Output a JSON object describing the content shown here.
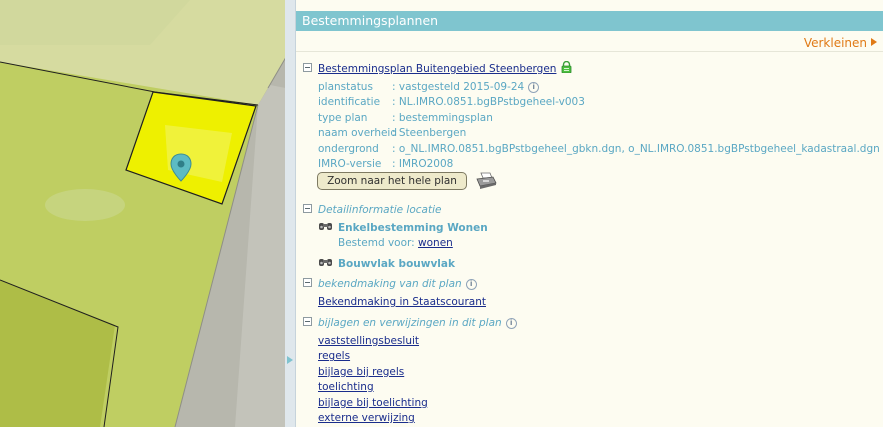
{
  "panel": {
    "title": "Bestemmingsplannen",
    "collapse_label": "Verkleinen",
    "plan": {
      "name": "Bestemmingsplan Buitengebied Steenbergen",
      "properties": [
        {
          "key": "planstatus",
          "value": ": vastgesteld 2015-09-24",
          "info": true
        },
        {
          "key": "identificatie",
          "value": ": NL.IMRO.0851.bgBPstbgeheel-v003",
          "info": false
        },
        {
          "key": "type plan",
          "value": ": bestemmingsplan",
          "info": false
        },
        {
          "key": "naam overheid",
          "value": ": Steenbergen",
          "info": false
        },
        {
          "key": "ondergrond",
          "value": ": o_NL.IMRO.0851.bgBPstbgeheel_gbkn.dgn, o_NL.IMRO.0851.bgBPstbgeheel_kadastraal.dgn",
          "info": false
        },
        {
          "key": "IMRO-versie",
          "value": ": IMRO2008",
          "info": false
        }
      ],
      "zoom_button": "Zoom naar het hele plan"
    },
    "detail": {
      "title": "Detailinformatie locatie",
      "items": [
        {
          "name": "Enkelbestemming Wonen",
          "sub_label": "Bestemd voor:",
          "sub_link": "wonen"
        },
        {
          "name": "Bouwvlak bouwvlak"
        }
      ]
    },
    "bekendmaking": {
      "title": "bekendmaking van dit plan",
      "link": "Bekendmaking in Staatscourant"
    },
    "bijlagen": {
      "title": "bijlagen en verwijzingen in dit plan",
      "links": [
        "vaststellingsbesluit",
        "regels",
        "bijlage bij regels",
        "toelichting",
        "bijlage bij toelichting",
        "externe verwijzing"
      ]
    }
  },
  "icons": {
    "expand": "minus-box-icon",
    "lock": "lock-icon",
    "info": "info-icon",
    "printer": "printer-icon",
    "binoculars": "binoculars-icon",
    "map_marker": "map-marker-icon"
  },
  "colors": {
    "header_bg": "#7fc5cf",
    "link": "#1a2d8c",
    "label": "#5aa7c3",
    "accent_orange": "#e07a16",
    "selection_yellow": "#eef000"
  }
}
